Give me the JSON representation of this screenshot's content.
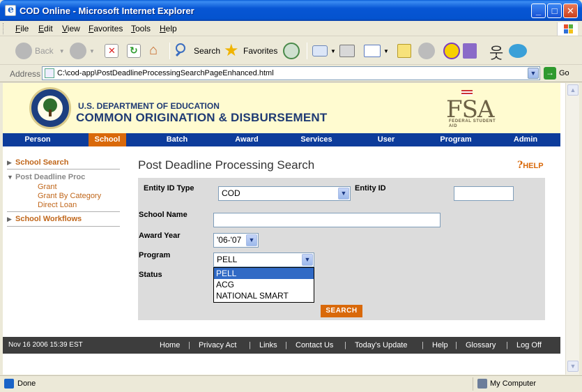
{
  "window": {
    "title": "COD Online - Microsoft Internet Explorer",
    "min": "_",
    "max": "□",
    "close": "✕"
  },
  "menubar": {
    "items": [
      "File",
      "Edit",
      "View",
      "Favorites",
      "Tools",
      "Help"
    ]
  },
  "toolbar": {
    "back": "Back",
    "search": "Search",
    "favorites": "Favorites"
  },
  "address": {
    "label": "Address",
    "url": "C:\\cod-app\\PostDeadlineProcessingSearchPageEnhanced.html",
    "go": "Go"
  },
  "header": {
    "dept": "U.S. DEPARTMENT OF EDUCATION",
    "system": "COMMON ORIGINATION & DISBURSEMENT",
    "fsa": "FSA",
    "fsa_sub": "FEDERAL STUDENT AID"
  },
  "nav": {
    "items": [
      "Person",
      "School",
      "Batch",
      "Award",
      "Services",
      "User",
      "Program",
      "Admin"
    ],
    "active": "School"
  },
  "sidebar": {
    "school_search": "School Search",
    "post_deadline": "Post Deadline Proc",
    "sub": [
      "Grant",
      "Grant By Category",
      "Direct Loan"
    ],
    "workflows": "School Workflows"
  },
  "main": {
    "title": "Post Deadline Processing Search",
    "help": "HELP"
  },
  "form": {
    "entity_id_type_label": "Entity ID Type",
    "entity_id_type_value": "COD",
    "entity_id_label": "Entity ID",
    "entity_id_value": "",
    "school_name_label": "School Name",
    "school_name_value": "",
    "award_year_label": "Award Year",
    "award_year_value": "'06-'07",
    "program_label": "Program",
    "program_value": "PELL",
    "program_options": [
      "PELL",
      "ACG",
      "NATIONAL SMART"
    ],
    "status_label": "Status",
    "search_button": "SEARCH"
  },
  "footer": {
    "datetime": "Nov 16 2006 15:39 EST",
    "links": [
      "Home",
      "Privacy Act",
      "Links",
      "Contact Us",
      "Today's Update",
      "Help",
      "Glossary",
      "Log Off"
    ],
    "sep": "|"
  },
  "status": {
    "text": "Done",
    "zone": "My Computer"
  }
}
